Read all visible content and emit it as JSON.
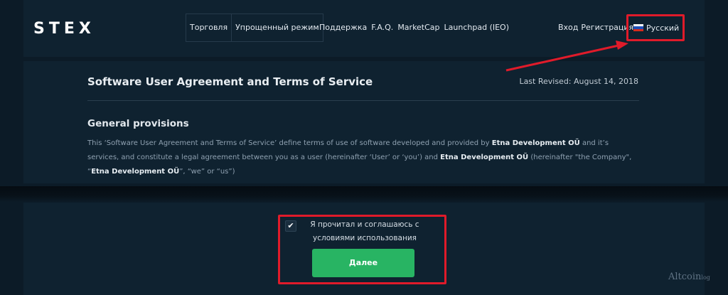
{
  "header": {
    "logo": "STEX",
    "nav_boxed": [
      "Торговля",
      "Упрощенный режим"
    ],
    "nav_plain": [
      "Поддержка",
      "F.A.Q.",
      "MarketCap",
      "Launchpad (IEO)"
    ],
    "login": "Вход",
    "register": "Регистрация",
    "language": "Русский"
  },
  "document": {
    "title": "Software User Agreement and Terms of Service",
    "revised": "Last Revised: August 14, 2018",
    "section_title": "General provisions",
    "para": {
      "p1": "This ‘Software User Agreement and Terms of Service’ define terms of use of software developed and provided by ",
      "company1": "Etna Development OÜ",
      "p2": " and it’s services, and constitute a legal agreement between you as a user (hereinafter ‘User’ or ‘you’) and ",
      "company2": "Etna Development OÜ",
      "p3": " (hereinafter \"the Company\", “",
      "company3": "Etna Development OÜ",
      "p4": "”, “we” or “us”)"
    }
  },
  "agreement": {
    "checkbox_mark": "✔",
    "text": "Я прочитал и соглашаюсь с условиями использования",
    "button": "Далее"
  },
  "watermark": {
    "main": "Altcoin",
    "suffix": "log"
  },
  "colors": {
    "annotation": "#e01b2a",
    "button": "#28b463",
    "background": "#0c1b27",
    "panel": "#0f2230"
  }
}
